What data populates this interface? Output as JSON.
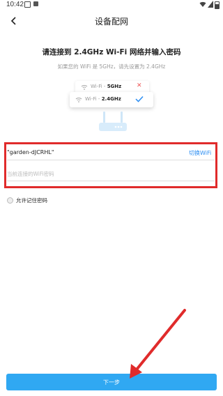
{
  "status_bar": {
    "time": "10:42"
  },
  "nav": {
    "title": "设备配网"
  },
  "content": {
    "heading": "请连接到 2.4GHz Wi-Fi 网络并输入密码",
    "subheading": "如果您的 WiFi 是 5GHz，请先设置为 2.4GHz"
  },
  "illustration": {
    "row1_prefix": "Wi-Fi - ",
    "row1_band": "5GHz",
    "row2_prefix": "Wi-Fi - ",
    "row2_band": "2.4GHz"
  },
  "form": {
    "ssid_value": "\"garden-dJCRHL\"",
    "switch_wifi_label": "切换WiFi",
    "password_placeholder": "当前连接的WiFi密码",
    "password_value": "",
    "remember_label": "允许记住密码"
  },
  "footer": {
    "next_label": "下一步"
  },
  "colors": {
    "accent": "#2a8df2",
    "button": "#30a8f2",
    "annotation": "#e02b2b"
  }
}
